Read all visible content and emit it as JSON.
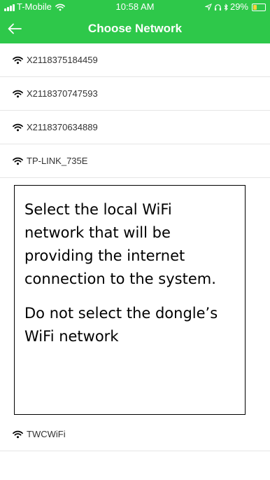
{
  "status_bar": {
    "carrier": "T-Mobile",
    "time": "10:58 AM",
    "battery": "29%",
    "battery_level": 0.29
  },
  "nav": {
    "title": "Choose Network",
    "back_icon": "arrow-left-icon"
  },
  "networks": [
    "X2118375184459",
    "X2118370747593",
    "X2118370634889",
    "TP-LINK_735E"
  ],
  "last_network": "TWCWiFi",
  "overlay": {
    "paragraph1": "Select the local WiFi network that will be providing the internet connection to the system.",
    "paragraph2": "Do not select the dongle’s WiFi network"
  },
  "colors": {
    "header": "#2ec84a",
    "battery": "#f7d23a"
  }
}
